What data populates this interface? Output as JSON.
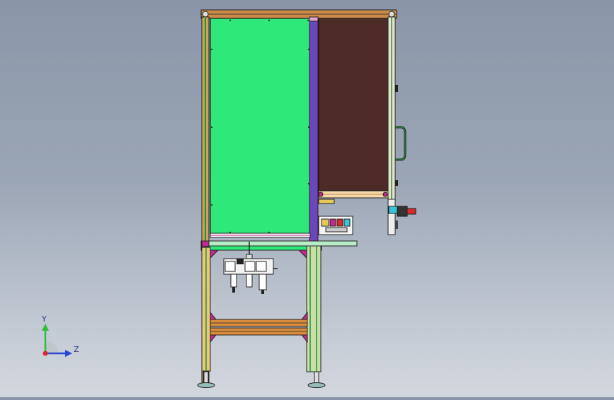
{
  "viewport": {
    "triad": {
      "y_label": "Y",
      "z_label": "Z"
    },
    "colors": {
      "green_panel": "#2ee97a",
      "brown_panel": "#4d2b27",
      "frame_orange": "#d98c3c",
      "frame_green": "#2a8f3a",
      "frame_purple": "#7c3fb5",
      "magenta": "#c0298f",
      "accent_red": "#d82a2a",
      "accent_cyan": "#37c6d8"
    }
  }
}
